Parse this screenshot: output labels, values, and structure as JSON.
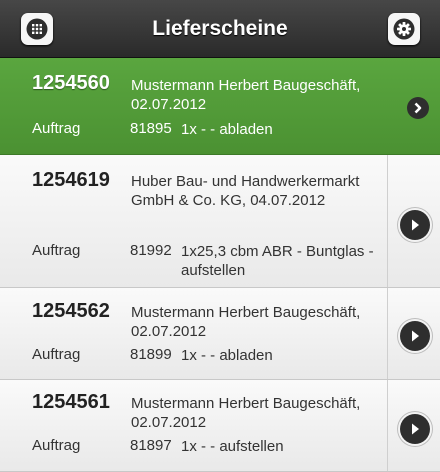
{
  "header": {
    "title": "Lieferscheine",
    "menu_icon": "grid-menu-icon",
    "settings_icon": "gear-icon"
  },
  "colors": {
    "selected_bg": "#52a038",
    "header_bg": "#3a3a3a"
  },
  "items": [
    {
      "number": "1254560",
      "customer": "Mustermann Herbert Baugeschäft, 02.07.2012",
      "label": "Auftrag",
      "order": "81895",
      "description": "1x - - abladen",
      "selected": true
    },
    {
      "number": "1254619",
      "customer": "Huber Bau- und Handwerkermarkt GmbH & Co. KG, 04.07.2012",
      "label": "Auftrag",
      "order": "81992",
      "description": "1x25,3 cbm ABR - Buntglas - aufstellen",
      "selected": false
    },
    {
      "number": "1254562",
      "customer": "Mustermann Herbert Baugeschäft, 02.07.2012",
      "label": "Auftrag",
      "order": "81899",
      "description": "1x - - abladen",
      "selected": false
    },
    {
      "number": "1254561",
      "customer": "Mustermann Herbert Baugeschäft, 02.07.2012",
      "label": "Auftrag",
      "order": "81897",
      "description": "1x - - aufstellen",
      "selected": false
    }
  ]
}
